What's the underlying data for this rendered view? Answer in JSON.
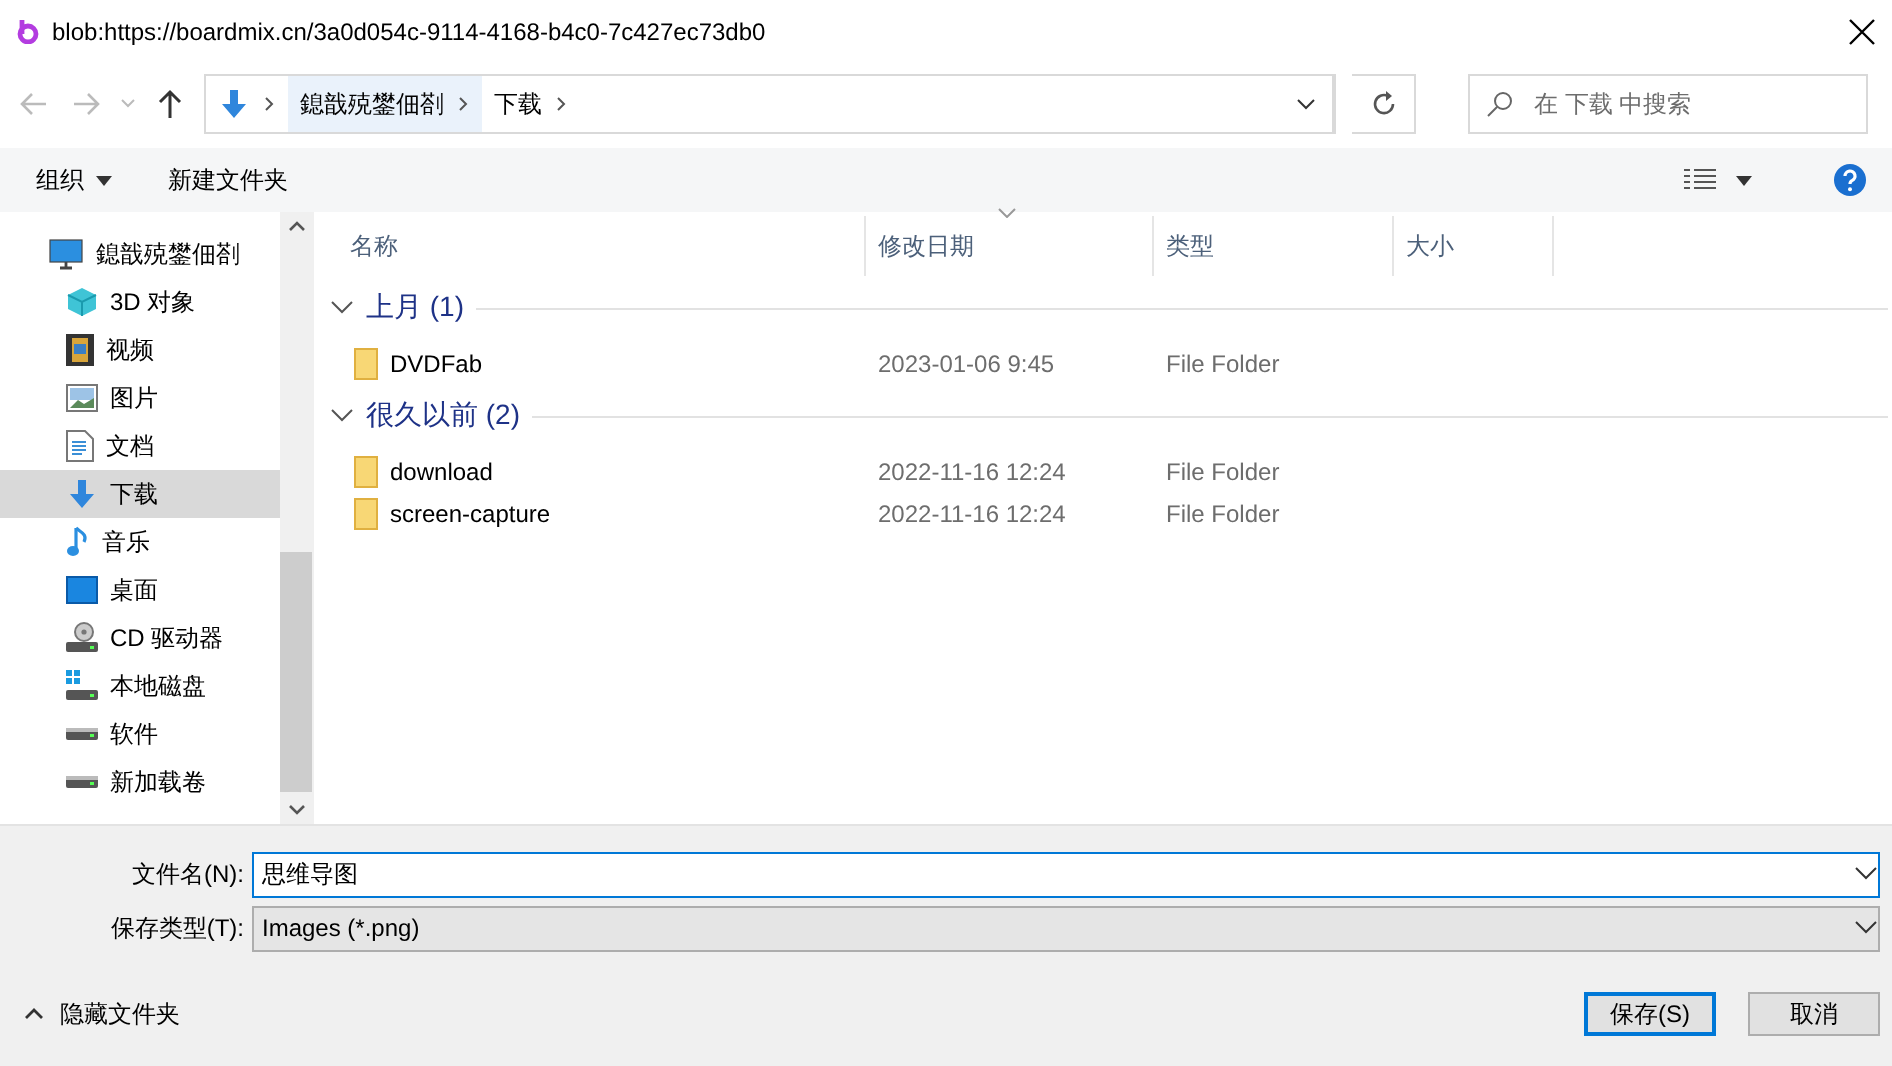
{
  "window": {
    "title": "blob:https://boardmix.cn/3a0d054c-9114-4168-b4c0-7c427ec73db0"
  },
  "address": {
    "crumbs": [
      "鎴戠殑鐢佃剳",
      "下载"
    ]
  },
  "search": {
    "placeholder": "在 下载 中搜索"
  },
  "toolbar": {
    "organize": "组织",
    "new_folder": "新建文件夹"
  },
  "sidebar": {
    "items": [
      {
        "label": "鎴戠殑鐢佃剳",
        "kind": "pc",
        "selected": false,
        "children": [
          {
            "label": "3D 对象",
            "kind": "cube",
            "selected": false
          },
          {
            "label": "视频",
            "kind": "video",
            "selected": false
          },
          {
            "label": "图片",
            "kind": "image",
            "selected": false
          },
          {
            "label": "文档",
            "kind": "doc",
            "selected": false
          },
          {
            "label": "下载",
            "kind": "download",
            "selected": true
          },
          {
            "label": "音乐",
            "kind": "music",
            "selected": false
          },
          {
            "label": "桌面",
            "kind": "desktop",
            "selected": false
          },
          {
            "label": "CD 驱动器",
            "kind": "cd",
            "selected": false
          },
          {
            "label": "本地磁盘",
            "kind": "sysdrive",
            "selected": false
          },
          {
            "label": "软件",
            "kind": "drive",
            "selected": false
          },
          {
            "label": "新加载卷",
            "kind": "drive",
            "selected": false
          }
        ]
      }
    ]
  },
  "table": {
    "columns": [
      "名称",
      "修改日期",
      "类型",
      "大小"
    ],
    "groups": [
      {
        "title": "上月 (1)",
        "expanded": true,
        "rows": [
          {
            "name": "DVDFab",
            "date": "2023-01-06 9:45",
            "type": "File Folder"
          }
        ]
      },
      {
        "title": "很久以前 (2)",
        "expanded": true,
        "rows": [
          {
            "name": "download",
            "date": "2022-11-16 12:24",
            "type": "File Folder"
          },
          {
            "name": "screen-capture",
            "date": "2022-11-16 12:24",
            "type": "File Folder"
          }
        ]
      }
    ]
  },
  "filename": {
    "label": "文件名(N):",
    "value": "思维导图"
  },
  "filetype": {
    "label": "保存类型(T):",
    "value": "Images (*.png)"
  },
  "hide_folders": "隐藏文件夹",
  "buttons": [
    {
      "label": "保存(S)",
      "default": true
    },
    {
      "label": "取消",
      "default": false
    }
  ]
}
